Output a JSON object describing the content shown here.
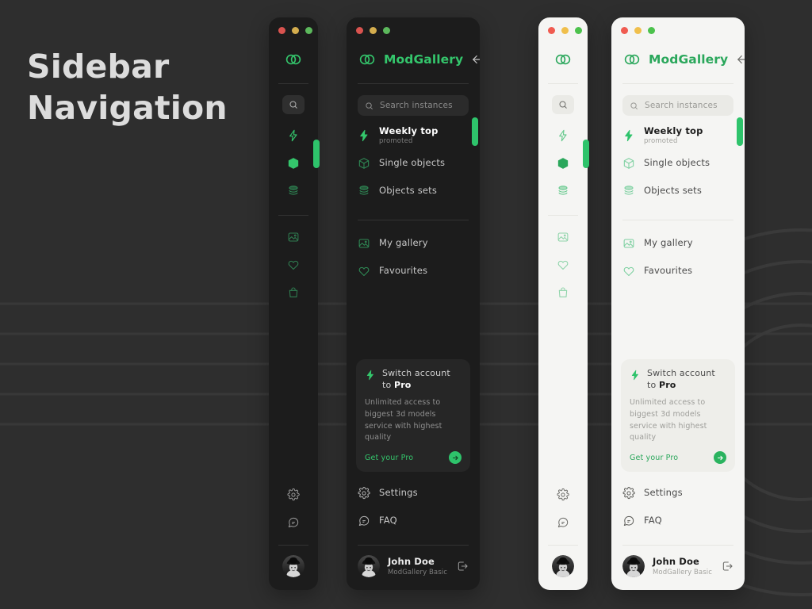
{
  "heading": {
    "line1": "Sidebar",
    "line2": "Navigation"
  },
  "brand": {
    "name": "ModGallery",
    "logo_icon": "overlapping-circles-logo"
  },
  "window_controls": {
    "close_label": "close",
    "minimize_label": "minimize",
    "maximize_label": "maximize",
    "dark_colors": [
      "#d9534f",
      "#d4ad4e",
      "#5cb85c"
    ],
    "light_colors": [
      "#f05b50",
      "#f0bf4b",
      "#4cc24c"
    ]
  },
  "collapse_button": {
    "icon": "arrow-left-icon",
    "label": "Collapse sidebar"
  },
  "search": {
    "placeholder": "Search instances",
    "value": "",
    "icon": "search-icon"
  },
  "nav_primary": [
    {
      "id": "weekly-top",
      "label": "Weekly top",
      "sublabel": "promoted",
      "icon": "lightning-bolt-icon",
      "active": true
    },
    {
      "id": "single-objects",
      "label": "Single objects",
      "sublabel": "",
      "icon": "cube-icon",
      "active": false
    },
    {
      "id": "objects-sets",
      "label": "Objects sets",
      "sublabel": "",
      "icon": "layers-icon",
      "active": false
    }
  ],
  "nav_secondary": [
    {
      "id": "my-gallery",
      "label": "My gallery",
      "icon": "image-icon",
      "active": false
    },
    {
      "id": "favourites",
      "label": "Favourites",
      "icon": "heart-icon",
      "active": false
    }
  ],
  "nav_collapsed_extra": [
    {
      "id": "shop",
      "label": "Shop",
      "icon": "shopping-bag-icon",
      "active": false
    }
  ],
  "nav_collapsed_active_id": "single-objects",
  "pro_card": {
    "icon": "lightning-bolt-icon",
    "title_prefix": "Switch account to ",
    "title_strong": "Pro",
    "description": "Unlimited access to biggest 3d models service with highest quality",
    "cta_label": "Get your Pro",
    "cta_icon": "arrow-right-circle-icon"
  },
  "nav_bottom": [
    {
      "id": "settings",
      "label": "Settings",
      "icon": "gear-icon"
    },
    {
      "id": "faq",
      "label": "FAQ",
      "icon": "chat-bubble-icon"
    }
  ],
  "user": {
    "name": "John Doe",
    "plan": "ModGallery Basic",
    "avatar_icon": "user-avatar-photo",
    "logout_icon": "logout-icon"
  },
  "colors": {
    "accent_green": "#34c66c",
    "accent_green_light": "#2aa75b",
    "active_pill": "#2ec36b",
    "dark_panel_bg": "#1c1c1c",
    "light_panel_bg": "#f5f5f3",
    "page_bg": "#2e2e2e",
    "heading_text": "#dcdcdc"
  }
}
